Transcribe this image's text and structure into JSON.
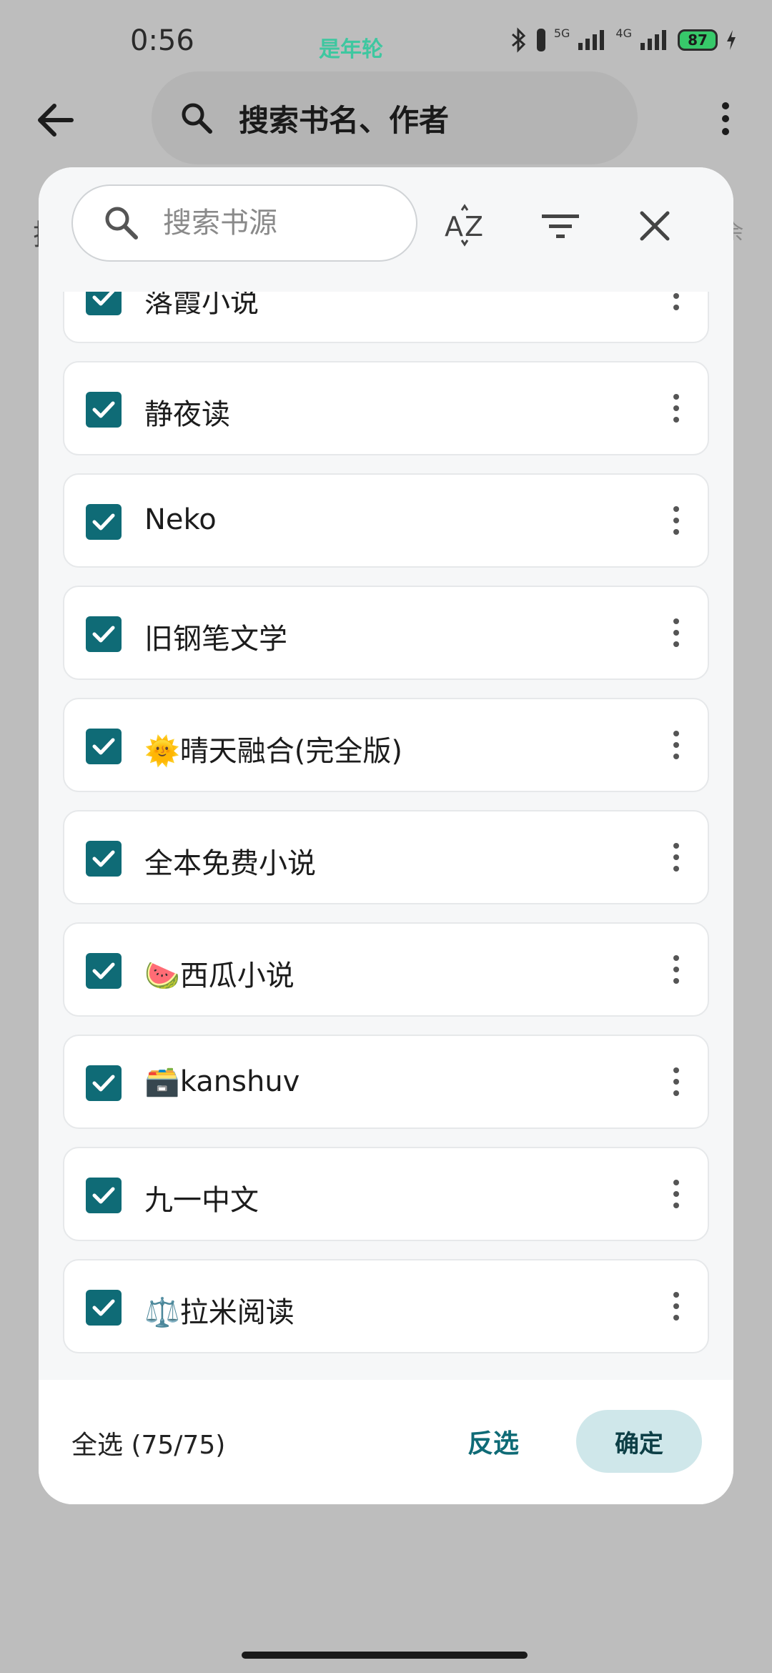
{
  "status_bar": {
    "time": "0:56",
    "carrier_text": "是年轮",
    "net_5g": "5G",
    "net_4g": "4G",
    "battery": "87"
  },
  "app_bar": {
    "search_placeholder": "搜索书名、作者",
    "behind_left_text": "搜",
    "behind_right_text": "余"
  },
  "dialog": {
    "search_placeholder": "搜索书源",
    "sort_icon": "sort-az-icon",
    "filter_icon": "filter-icon",
    "close_icon": "close-icon",
    "items": [
      {
        "label": "落霞小说",
        "checked": true
      },
      {
        "label": "静夜读",
        "checked": true
      },
      {
        "label": "Neko",
        "checked": true
      },
      {
        "label": "旧钢笔文学",
        "checked": true
      },
      {
        "label": "🌞晴天融合(完全版)",
        "checked": true
      },
      {
        "label": "全本免费小说",
        "checked": true
      },
      {
        "label": "🍉西瓜小说",
        "checked": true
      },
      {
        "label": "🗃️kanshuv",
        "checked": true
      },
      {
        "label": "九一中文",
        "checked": true
      },
      {
        "label": "⚖️拉米阅读",
        "checked": true
      }
    ],
    "footer": {
      "select_all": "全选 (75/75)",
      "invert": "反选",
      "confirm": "确定"
    }
  },
  "colors": {
    "accent": "#0f6b76",
    "confirm_bg": "#cfe7ea",
    "scrim": "#bdbdbd"
  }
}
